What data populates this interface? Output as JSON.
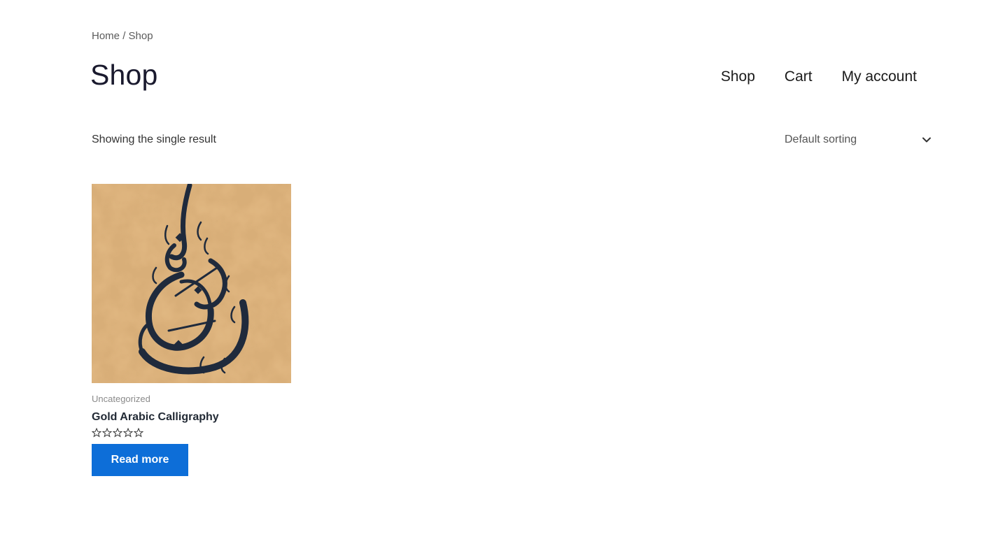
{
  "breadcrumb": {
    "home": "Home",
    "separator": "/",
    "current": "Shop"
  },
  "page_title": "Shop",
  "nav": {
    "items": [
      {
        "label": "Shop"
      },
      {
        "label": "Cart"
      },
      {
        "label": "My account"
      }
    ]
  },
  "result_count": "Showing the single result",
  "ordering": {
    "selected": "Default sorting",
    "icon": "chevron-down-icon"
  },
  "product": {
    "category": "Uncategorized",
    "title": "Gold Arabic Calligraphy",
    "rating_stars": 5,
    "rating_value": 0,
    "button_label": "Read more"
  },
  "colors": {
    "accent": "#0d6ed8",
    "button_text": "#ffffff",
    "artwork_background": "#d8ae78",
    "artwork_ink": "#1f2a3c"
  }
}
